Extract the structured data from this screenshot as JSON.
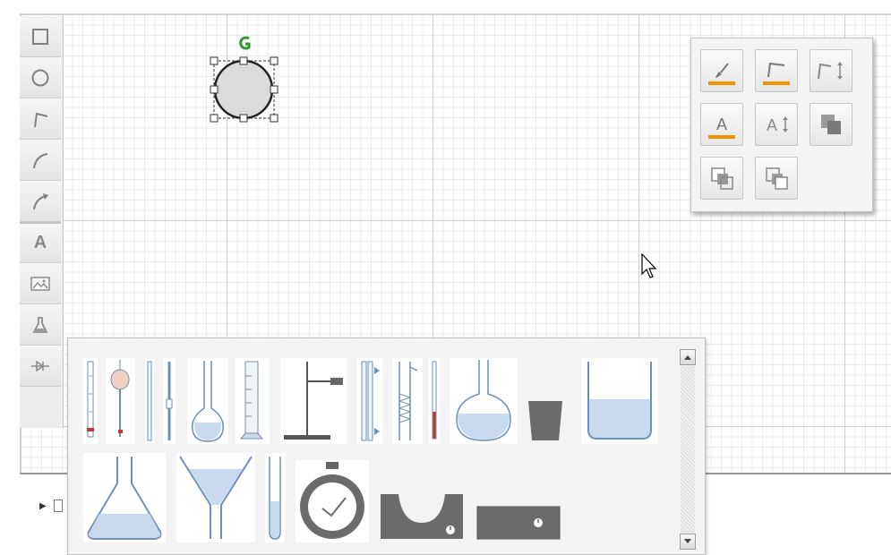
{
  "toolbar": {
    "tools": [
      {
        "name": "rectangle",
        "icon": "rectangle-icon"
      },
      {
        "name": "ellipse",
        "icon": "ellipse-icon"
      },
      {
        "name": "line",
        "icon": "polyline-icon"
      },
      {
        "name": "curve",
        "icon": "curve-icon"
      },
      {
        "name": "arrow",
        "icon": "curved-arrow-icon"
      },
      {
        "name": "text",
        "icon": "text-icon",
        "label": "A"
      },
      {
        "name": "image",
        "icon": "image-icon"
      },
      {
        "name": "lab",
        "icon": "flask-icon"
      },
      {
        "name": "connector",
        "icon": "diode-icon"
      }
    ]
  },
  "format_panel": {
    "accent_color": "#f29400",
    "buttons": [
      {
        "name": "fill-color",
        "icon": "paint-brush-icon"
      },
      {
        "name": "line-color",
        "icon": "line-color-icon"
      },
      {
        "name": "line-width",
        "icon": "line-width-icon"
      },
      {
        "name": "text-color",
        "icon": "text-color-icon",
        "label": "A"
      },
      {
        "name": "text-size",
        "icon": "text-size-icon",
        "label": "A"
      },
      {
        "name": "arrange",
        "icon": "arrange-icon"
      },
      {
        "name": "bring-forward",
        "icon": "bring-forward-icon"
      },
      {
        "name": "send-backward",
        "icon": "send-backward-icon"
      }
    ]
  },
  "selection": {
    "shape": "circle",
    "fill": "#dcdcdc",
    "rotate_handle_color": "#2d9a2d"
  },
  "palette": {
    "liquid_color": "#c9daef",
    "items": [
      "burette",
      "pipette",
      "capillary-tube",
      "dropper-tube",
      "volumetric-flask",
      "graduated-cylinder",
      "retort-stand",
      "condenser",
      "coil-condenser",
      "thermometer",
      "round-bottom-flask",
      "crucible",
      "beaker",
      "conical-flask",
      "funnel",
      "test-tube",
      "stopwatch",
      "heating-mantle",
      "hot-plate"
    ]
  }
}
